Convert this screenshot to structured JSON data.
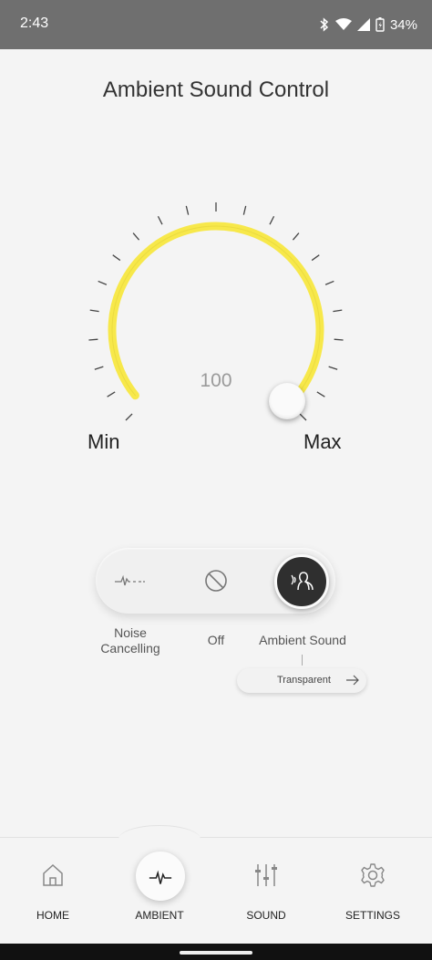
{
  "status_bar": {
    "time": "2:43",
    "battery": "34%"
  },
  "title": "Ambient Sound Control",
  "dial": {
    "value": "100",
    "min_label": "Min",
    "max_label": "Max",
    "level": 1.0,
    "accent": "#f7e84a"
  },
  "modes": {
    "noise_cancelling": "Noise\nCancelling",
    "off": "Off",
    "ambient_sound": "Ambient Sound",
    "selected": "ambient_sound"
  },
  "ambient_option": {
    "label": "Transparent"
  },
  "nav": {
    "items": [
      {
        "label": "HOME",
        "icon": "home-icon"
      },
      {
        "label": "AMBIENT",
        "icon": "waveform-icon"
      },
      {
        "label": "SOUND",
        "icon": "equalizer-icon"
      },
      {
        "label": "SETTINGS",
        "icon": "gear-icon"
      }
    ],
    "active": 1
  }
}
